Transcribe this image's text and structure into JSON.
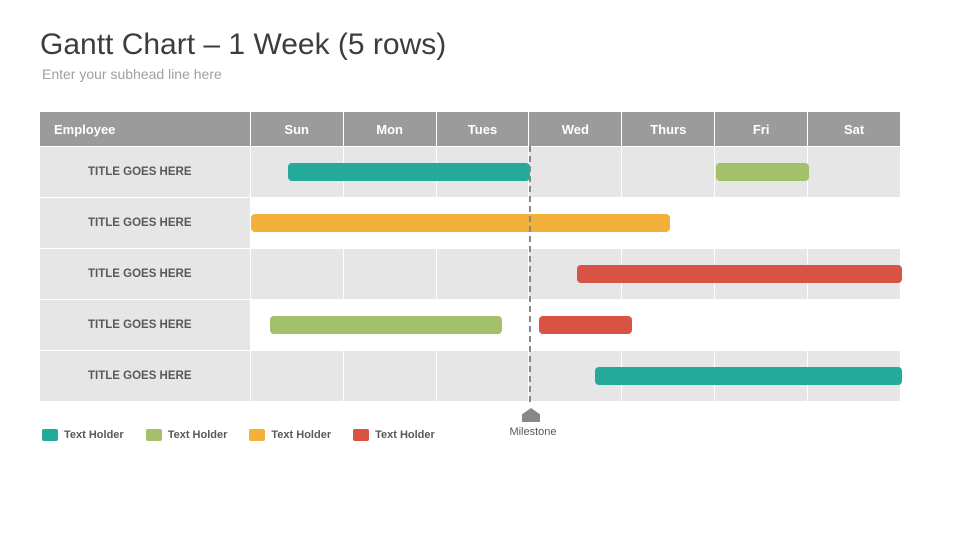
{
  "title": "Gantt Chart – 1 Week (5 rows)",
  "subtitle": "Enter your subhead line here",
  "header": {
    "employee": "Employee",
    "days": [
      "Sun",
      "Mon",
      "Tues",
      "Wed",
      "Thurs",
      "Fri",
      "Sat"
    ]
  },
  "rows": [
    {
      "label": "TITLE GOES HERE"
    },
    {
      "label": "TITLE GOES HERE"
    },
    {
      "label": "TITLE GOES HERE"
    },
    {
      "label": "TITLE GOES HERE"
    },
    {
      "label": "TITLE GOES HERE"
    }
  ],
  "milestone": {
    "day": 3,
    "label": "Milestone"
  },
  "legend": [
    {
      "label": "Text Holder",
      "color": "#24a99a"
    },
    {
      "label": "Text Holder",
      "color": "#a3c06a"
    },
    {
      "label": "Text Holder",
      "color": "#f3b13c"
    },
    {
      "label": "Text Holder",
      "color": "#d95344"
    }
  ],
  "chart_data": {
    "type": "bar",
    "title": "Gantt Chart – 1 Week (5 rows)",
    "xlabel": "",
    "ylabel": "",
    "categories": [
      "Sun",
      "Mon",
      "Tues",
      "Wed",
      "Thurs",
      "Fri",
      "Sat"
    ],
    "ylim": [
      0,
      7
    ],
    "series": [
      {
        "name": "Text Holder",
        "color": "#24a99a",
        "bars": [
          {
            "row": 0,
            "start": 0.4,
            "end": 3.0
          },
          {
            "row": 4,
            "start": 3.7,
            "end": 7.0
          }
        ]
      },
      {
        "name": "Text Holder",
        "color": "#a3c06a",
        "bars": [
          {
            "row": 0,
            "start": 5.0,
            "end": 6.0
          },
          {
            "row": 3,
            "start": 0.2,
            "end": 2.7
          }
        ]
      },
      {
        "name": "Text Holder",
        "color": "#f3b13c",
        "bars": [
          {
            "row": 1,
            "start": 0.0,
            "end": 4.5
          }
        ]
      },
      {
        "name": "Text Holder",
        "color": "#d95344",
        "bars": [
          {
            "row": 2,
            "start": 3.5,
            "end": 7.0
          },
          {
            "row": 3,
            "start": 3.1,
            "end": 4.1
          }
        ]
      }
    ],
    "milestone": {
      "x": 3.0,
      "label": "Milestone"
    }
  }
}
